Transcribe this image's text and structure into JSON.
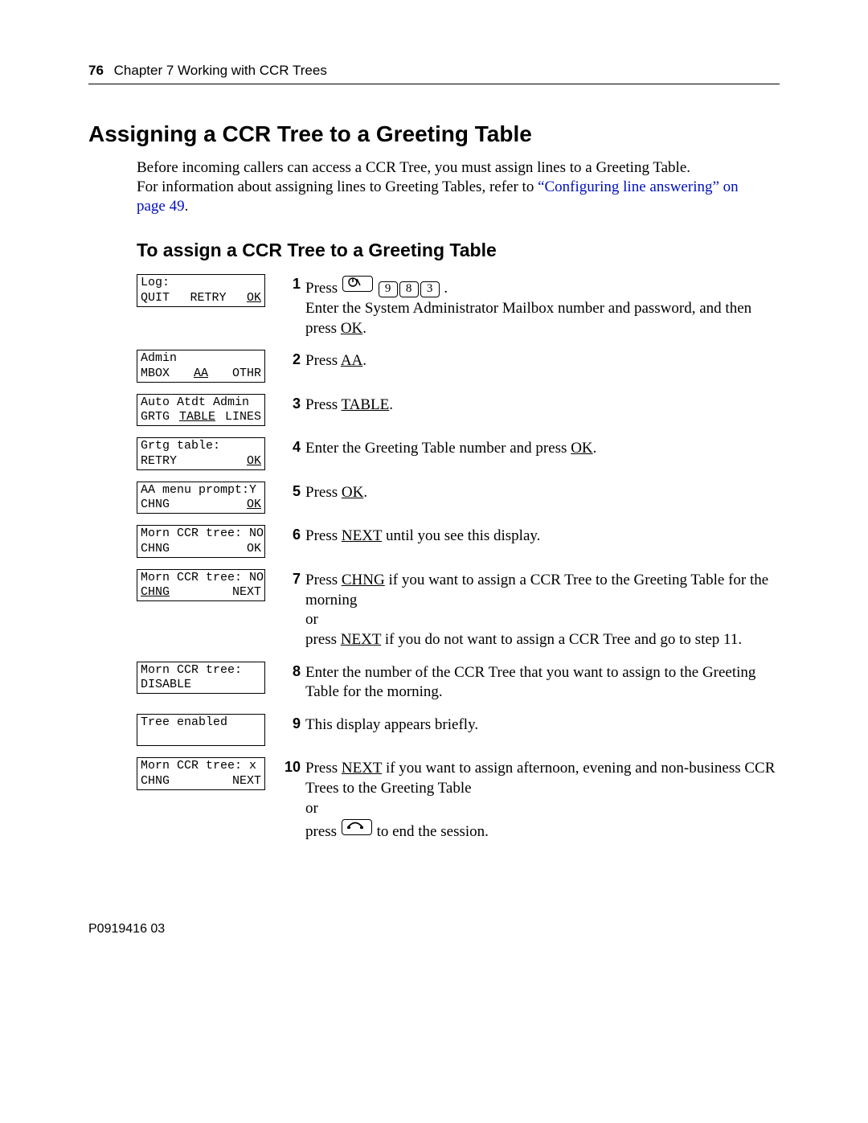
{
  "header": {
    "page_num": "76",
    "chapter": "Chapter 7  Working with CCR Trees"
  },
  "h1": "Assigning a CCR Tree to a Greeting Table",
  "intro": {
    "line1": "Before incoming callers can access a CCR Tree, you must assign lines to a Greeting Table.",
    "line2a": "For information about assigning lines to Greeting Tables, refer to ",
    "link1": "“Configuring line answering” on",
    "link2": "page 49",
    "period": "."
  },
  "h2": "To assign a CCR Tree to a Greeting Table",
  "lcd": {
    "s1": {
      "r1": "Log:",
      "k1": "QUIT",
      "k2": "RETRY",
      "k3": "OK",
      "u1": false,
      "u2": false,
      "u3": true
    },
    "s2": {
      "r1": "Admin",
      "k1": "MBOX",
      "k2": "AA",
      "k3": "OTHR",
      "u1": false,
      "u2": true,
      "u3": false
    },
    "s3": {
      "r1": "Auto Atdt Admin",
      "k1": "GRTG",
      "k2": "TABLE",
      "k3": "LINES",
      "u1": false,
      "u2": true,
      "u3": false
    },
    "s4": {
      "r1": "Grtg table:",
      "k1": "RETRY",
      "k2": "",
      "k3": "OK",
      "u1": false,
      "u2": false,
      "u3": true
    },
    "s5": {
      "r1": "AA menu prompt:Y",
      "k1": "CHNG",
      "k2": "",
      "k3": "OK",
      "u1": false,
      "u2": false,
      "u3": true
    },
    "s6": {
      "r1": "Morn CCR tree: NO",
      "k1": "CHNG",
      "k2": "",
      "k3": "OK",
      "u1": false,
      "u2": false,
      "u3": false
    },
    "s7": {
      "r1": "Morn CCR tree: NO",
      "k1": "CHNG",
      "k2": "",
      "k3": "NEXT",
      "u1": true,
      "u2": false,
      "u3": false
    },
    "s8": {
      "r1": "Morn CCR tree:",
      "k1": "DISABLE",
      "k2": "",
      "k3": "",
      "u1": false,
      "u2": false,
      "u3": false
    },
    "s9": {
      "r1": "Tree enabled",
      "k1": " ",
      "k2": "",
      "k3": "",
      "u1": false,
      "u2": false,
      "u3": false
    },
    "s10": {
      "r1": "Morn CCR tree: x",
      "k1": "CHNG",
      "k2": "",
      "k3": "NEXT",
      "u1": false,
      "u2": false,
      "u3": false
    }
  },
  "steps": {
    "s1": {
      "n": "1",
      "pre": "Press ",
      "keys": [
        "9",
        "8",
        "3"
      ],
      "post": " .",
      "line2": "Enter the System Administrator Mailbox number and password, and then press ",
      "key2": "OK",
      "post2": "."
    },
    "s2": {
      "n": "2",
      "pre": "Press ",
      "key": "AA",
      "post": "."
    },
    "s3": {
      "n": "3",
      "pre": "Press ",
      "key": "TABLE",
      "post": "."
    },
    "s4": {
      "n": "4",
      "pre": "Enter the Greeting Table number and press ",
      "key": "OK",
      "post": "."
    },
    "s5": {
      "n": "5",
      "pre": "Press ",
      "key": "OK",
      "post": "."
    },
    "s6": {
      "n": "6",
      "pre": "Press ",
      "key": "NEXT",
      "post": " until you see this display."
    },
    "s7": {
      "n": "7",
      "a1": "Press ",
      "k1": "CHNG",
      "a2": " if you want to assign a CCR Tree to the Greeting Table for the morning",
      "or": "or",
      "b1": "press ",
      "k2": "NEXT",
      "b2": " if you do not want to assign a CCR Tree and go to step 11."
    },
    "s8": {
      "n": "8",
      "txt": "Enter the number of the CCR Tree that you want to assign to the Greeting Table for the morning."
    },
    "s9": {
      "n": "9",
      "txt": "This display appears briefly."
    },
    "s10": {
      "n": "10",
      "a1": "Press ",
      "k1": "NEXT",
      "a2": " if you want to assign afternoon, evening and non-business CCR Trees to the Greeting Table",
      "or": "or",
      "b1": "press ",
      "b2": " to end the session."
    }
  },
  "footer": "P0919416 03"
}
